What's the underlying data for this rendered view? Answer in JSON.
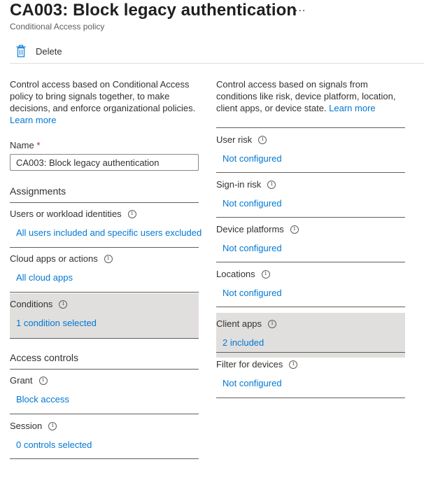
{
  "header": {
    "title": "CA003: Block legacy authentication",
    "more_label": "...",
    "subtitle": "Conditional Access policy"
  },
  "toolbar": {
    "delete_label": "Delete",
    "delete_icon": "trash-icon"
  },
  "left": {
    "description": "Control access based on Conditional Access policy to bring signals together, to make decisions, and enforce organizational policies.",
    "learn_more": "Learn more",
    "name_label": "Name",
    "required_mark": "*",
    "name_value": "CA003: Block legacy authentication",
    "assignments_heading": "Assignments",
    "users": {
      "label": "Users or workload identities",
      "value": "All users included and specific users excluded"
    },
    "cloud_apps": {
      "label": "Cloud apps or actions",
      "value": "All cloud apps"
    },
    "conditions": {
      "label": "Conditions",
      "value": "1 condition selected"
    },
    "access_controls_heading": "Access controls",
    "grant": {
      "label": "Grant",
      "value": "Block access"
    },
    "session": {
      "label": "Session",
      "value": "0 controls selected"
    }
  },
  "right": {
    "description": "Control access based on signals from conditions like risk, device platform, location, client apps, or device state.",
    "learn_more": "Learn more",
    "user_risk": {
      "label": "User risk",
      "value": "Not configured"
    },
    "signin_risk": {
      "label": "Sign-in risk",
      "value": "Not configured"
    },
    "device_platforms": {
      "label": "Device platforms",
      "value": "Not configured"
    },
    "locations": {
      "label": "Locations",
      "value": "Not configured"
    },
    "client_apps": {
      "label": "Client apps",
      "value": "2 included"
    },
    "filter_devices": {
      "label": "Filter for devices",
      "value": "Not configured"
    }
  },
  "info_glyph": "i",
  "colors": {
    "link": "#0078d4",
    "selected_bg": "#e1dfdd",
    "required": "#a4262c"
  }
}
